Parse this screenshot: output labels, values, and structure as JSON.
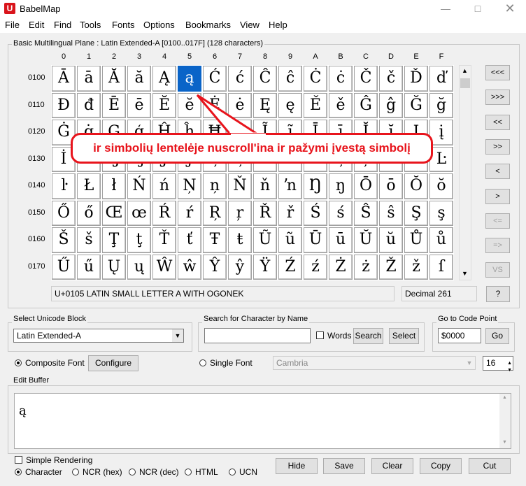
{
  "window": {
    "title": "BabelMap"
  },
  "menu": [
    "File",
    "Edit",
    "Find",
    "Tools",
    "Fonts",
    "Options",
    "Bookmarks",
    "View",
    "Help"
  ],
  "grid_panel": {
    "label": "Basic Multilingual Plane : Latin Extended-A [0100..017F] (128 characters)",
    "col_headers": [
      "0",
      "1",
      "2",
      "3",
      "4",
      "5",
      "6",
      "7",
      "8",
      "9",
      "A",
      "B",
      "C",
      "D",
      "E",
      "F"
    ],
    "row_headers": [
      "0100",
      "0110",
      "0120",
      "0130",
      "0140",
      "0150",
      "0160",
      "0170"
    ],
    "rows": [
      [
        "Ā",
        "ā",
        "Ă",
        "ă",
        "Ą",
        "ą",
        "Ć",
        "ć",
        "Ĉ",
        "ĉ",
        "Ċ",
        "ċ",
        "Č",
        "č",
        "Ď",
        "ď"
      ],
      [
        "Đ",
        "đ",
        "Ē",
        "ē",
        "Ĕ",
        "ĕ",
        "Ė",
        "ė",
        "Ę",
        "ę",
        "Ě",
        "ě",
        "Ĝ",
        "ĝ",
        "Ğ",
        "ğ"
      ],
      [
        "Ġ",
        "ġ",
        "Ģ",
        "ģ",
        "Ĥ",
        "ĥ",
        "Ħ",
        "ħ",
        "Ĩ",
        "ĩ",
        "Ī",
        "ī",
        "Ĭ",
        "ĭ",
        "Į",
        "į"
      ],
      [
        "İ",
        "ı",
        "Ĳ",
        "ĳ",
        "Ĵ",
        "ĵ",
        "Ķ",
        "ķ",
        "ĸ",
        "Ĺ",
        "ĺ",
        "Ļ",
        "ļ",
        "Ľ",
        "ľ",
        "Ŀ"
      ],
      [
        "ŀ",
        "Ł",
        "ł",
        "Ń",
        "ń",
        "Ņ",
        "ņ",
        "Ň",
        "ň",
        "ŉ",
        "Ŋ",
        "ŋ",
        "Ō",
        "ō",
        "Ŏ",
        "ŏ"
      ],
      [
        "Ő",
        "ő",
        "Œ",
        "œ",
        "Ŕ",
        "ŕ",
        "Ŗ",
        "ŗ",
        "Ř",
        "ř",
        "Ś",
        "ś",
        "Ŝ",
        "ŝ",
        "Ş",
        "ş"
      ],
      [
        "Š",
        "š",
        "Ţ",
        "ţ",
        "Ť",
        "ť",
        "Ŧ",
        "ŧ",
        "Ũ",
        "ũ",
        "Ū",
        "ū",
        "Ŭ",
        "ŭ",
        "Ů",
        "ů"
      ],
      [
        "Ű",
        "ű",
        "Ų",
        "ų",
        "Ŵ",
        "ŵ",
        "Ŷ",
        "ŷ",
        "Ÿ",
        "Ź",
        "ź",
        "Ż",
        "ż",
        "Ž",
        "ž",
        "ſ"
      ]
    ],
    "selected": {
      "row": 0,
      "col": 5
    },
    "nav_buttons": [
      "<<<",
      ">>>",
      "<<",
      ">>",
      "<",
      ">",
      "<=",
      "=>",
      "VS"
    ],
    "status_name": "U+0105 LATIN SMALL LETTER A WITH OGONEK",
    "status_decimal": "Decimal 261",
    "help_label": "?"
  },
  "callout": {
    "text": "ir simbolių lentelėje nuscroll'ina ir pažymi įvestą simbolį"
  },
  "unicode_block": {
    "label": "Select Unicode Block",
    "value": "Latin Extended-A"
  },
  "search": {
    "label": "Search for Character by Name",
    "value": "",
    "words_label": "Words",
    "search_label": "Search",
    "select_label": "Select"
  },
  "goto": {
    "label": "Go to Code Point",
    "value": "$0000",
    "go_label": "Go"
  },
  "font": {
    "composite_label": "Composite Font",
    "configure_label": "Configure",
    "single_label": "Single Font",
    "font_value": "Cambria",
    "size_value": "16"
  },
  "edit_buffer": {
    "label": "Edit Buffer",
    "text": "ą"
  },
  "bottom": {
    "simple_rendering": "Simple Rendering",
    "modes": [
      "Character",
      "NCR (hex)",
      "NCR (dec)",
      "HTML",
      "UCN"
    ],
    "buttons": [
      "Hide",
      "Save",
      "Clear",
      "Copy",
      "Cut"
    ]
  }
}
